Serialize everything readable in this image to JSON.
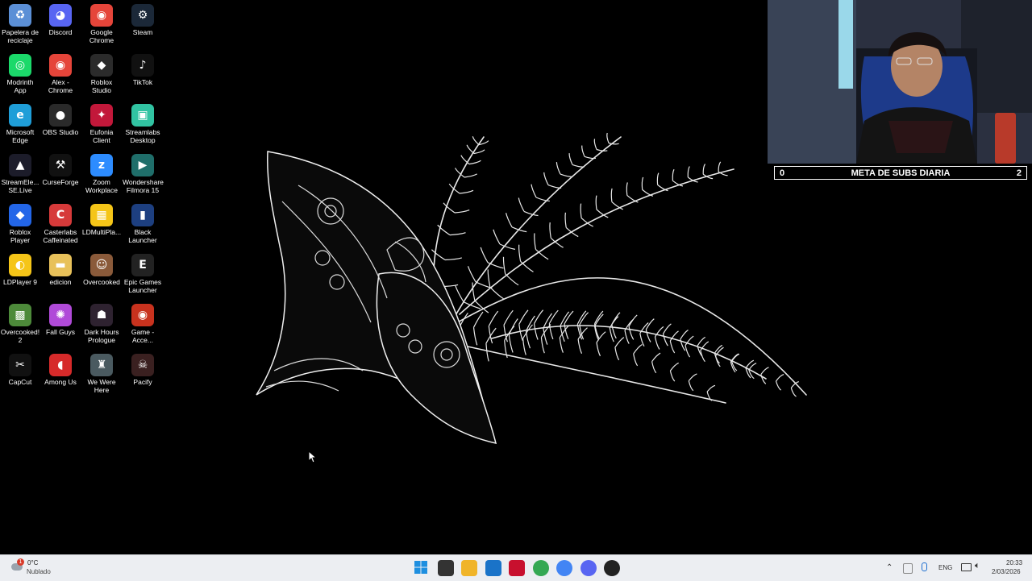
{
  "desktop": {
    "icons": [
      {
        "label": "Papelera de\nreciclaje",
        "icon": "recycle-bin-icon",
        "color": "#5b8fd6",
        "glyph": "♻"
      },
      {
        "label": "Discord",
        "icon": "discord-icon",
        "color": "#5865f2",
        "glyph": "◕"
      },
      {
        "label": "Google\nChrome",
        "icon": "chrome-icon",
        "color": "#e5453a",
        "glyph": "◉"
      },
      {
        "label": "Steam",
        "icon": "steam-icon",
        "color": "#1b2838",
        "glyph": "⚙"
      },
      {
        "label": "Modrinth\nApp",
        "icon": "modrinth-icon",
        "color": "#1bd96a",
        "glyph": "◎"
      },
      {
        "label": "Alex -\nChrome",
        "icon": "chrome-profile-icon",
        "color": "#e5453a",
        "glyph": "◉"
      },
      {
        "label": "Roblox\nStudio",
        "icon": "roblox-studio-icon",
        "color": "#2b2b2b",
        "glyph": "◆"
      },
      {
        "label": "TikTok",
        "icon": "tiktok-icon",
        "color": "#111111",
        "glyph": "♪"
      },
      {
        "label": "Microsoft\nEdge",
        "icon": "edge-icon",
        "color": "#1f9ed8",
        "glyph": "e"
      },
      {
        "label": "OBS Studio",
        "icon": "obs-icon",
        "color": "#2a2a2a",
        "glyph": "●"
      },
      {
        "label": "Eufonia\nClient",
        "icon": "eufonia-icon",
        "color": "#c2183a",
        "glyph": "✦"
      },
      {
        "label": "Streamlabs\nDesktop",
        "icon": "streamlabs-icon",
        "color": "#31c3a2",
        "glyph": "▣"
      },
      {
        "label": "StreamEle...\nSE.Live",
        "icon": "streamelements-icon",
        "color": "#1c1c2a",
        "glyph": "▲"
      },
      {
        "label": "CurseForge",
        "icon": "curseforge-icon",
        "color": "#111111",
        "glyph": "⚒"
      },
      {
        "label": "Zoom\nWorkplace",
        "icon": "zoom-icon",
        "color": "#2d8cff",
        "glyph": "z"
      },
      {
        "label": "Wondershare\nFilmora 15",
        "icon": "filmora-icon",
        "color": "#1f6e6a",
        "glyph": "▶"
      },
      {
        "label": "Roblox Player",
        "icon": "roblox-player-icon",
        "color": "#2366e8",
        "glyph": "◆"
      },
      {
        "label": "Casterlabs\nCaffeinated",
        "icon": "casterlabs-icon",
        "color": "#d63a3a",
        "glyph": "C"
      },
      {
        "label": "LDMultiPla...",
        "icon": "ldmultiplayer-icon",
        "color": "#f5c518",
        "glyph": "▦"
      },
      {
        "label": "Black\nLauncher",
        "icon": "black-launcher-icon",
        "color": "#1d3f80",
        "glyph": "▮"
      },
      {
        "label": "LDPlayer 9",
        "icon": "ldplayer-icon",
        "color": "#f5c518",
        "glyph": "◐"
      },
      {
        "label": "edicion",
        "icon": "folder-icon",
        "color": "#e8c15a",
        "glyph": "▬"
      },
      {
        "label": "Overcooked",
        "icon": "overcooked-icon",
        "color": "#8a5a3a",
        "glyph": "☺"
      },
      {
        "label": "Epic Games\nLauncher",
        "icon": "epic-games-icon",
        "color": "#222222",
        "glyph": "E"
      },
      {
        "label": "Overcooked!\n2",
        "icon": "overcooked2-icon",
        "color": "#4d8a3a",
        "glyph": "▩"
      },
      {
        "label": "Fall Guys",
        "icon": "fall-guys-icon",
        "color": "#b04ad8",
        "glyph": "✺"
      },
      {
        "label": "Dark Hours\nPrologue",
        "icon": "dark-hours-icon",
        "color": "#2e2230",
        "glyph": "☗"
      },
      {
        "label": "Game -\nAcce...",
        "icon": "game-access-icon",
        "color": "#c8321e",
        "glyph": "◉"
      },
      {
        "label": "CapCut",
        "icon": "capcut-icon",
        "color": "#111111",
        "glyph": "✂"
      },
      {
        "label": "Among Us",
        "icon": "among-us-icon",
        "color": "#d62a2a",
        "glyph": "◖"
      },
      {
        "label": "We Were\nHere",
        "icon": "we-were-here-icon",
        "color": "#4a5a60",
        "glyph": "♜"
      },
      {
        "label": "Pacify",
        "icon": "pacify-icon",
        "color": "#3a2020",
        "glyph": "☠"
      }
    ]
  },
  "stream_overlay": {
    "goal_label": "META DE SUBS DIARIA",
    "goal_current": "0",
    "goal_target": "2"
  },
  "taskbar": {
    "weather_temp": "0°C",
    "weather_desc": "Nublado",
    "weather_alert": "1",
    "language": "ENG",
    "time": "20:33",
    "date": "2/03/2026",
    "apps": [
      {
        "icon": "windows-start-icon",
        "color": "#1e8fe0"
      },
      {
        "icon": "task-view-icon",
        "color": "#333333"
      },
      {
        "icon": "file-explorer-icon",
        "color": "#f0b429"
      },
      {
        "icon": "microsoft-store-icon",
        "color": "#1a73c8"
      },
      {
        "icon": "mcafee-icon",
        "color": "#c8102e"
      },
      {
        "icon": "chrome-icon",
        "color": "#34a853"
      },
      {
        "icon": "chrome-profile-icon",
        "color": "#4285f4"
      },
      {
        "icon": "discord-icon",
        "color": "#5865f2"
      },
      {
        "icon": "obs-icon",
        "color": "#222222"
      }
    ]
  }
}
